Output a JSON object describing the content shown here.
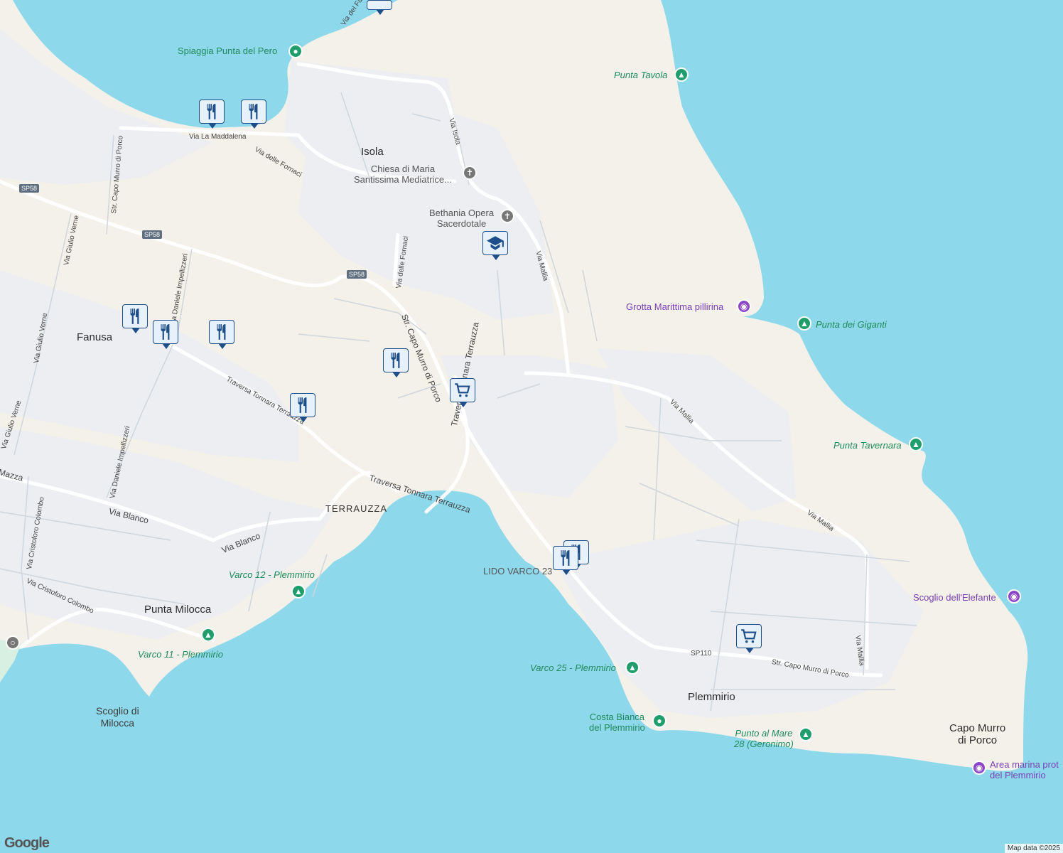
{
  "map": {
    "places": [
      {
        "key": "isola",
        "text": "Isola"
      },
      {
        "key": "fanusa",
        "text": "Fanusa"
      },
      {
        "key": "terrauzza",
        "text": "TERRAUZZA"
      },
      {
        "key": "punta-milocca",
        "text": "Punta Milocca"
      },
      {
        "key": "plemmirio",
        "text": "Plemmirio"
      },
      {
        "key": "capo-murro",
        "text": "Capo Murro\ndi Porco"
      },
      {
        "key": "scoglio-milocca",
        "text": "Scoglio di\nMilocca"
      }
    ],
    "pois": [
      {
        "key": "spiaggia",
        "text": "Spiaggia Punta del Pero",
        "kind": "green"
      },
      {
        "key": "punta-tavola",
        "text": "Punta Tavola",
        "kind": "green"
      },
      {
        "key": "chiesa",
        "text": "Chiesa di Maria\nSantissima Mediatrice...",
        "kind": "gray"
      },
      {
        "key": "bethania",
        "text": "Bethania Opera\nSacerdotale",
        "kind": "gray"
      },
      {
        "key": "grotta",
        "text": "Grotta Marittima pillirina",
        "kind": "purple"
      },
      {
        "key": "punta-giganti",
        "text": "Punta dei Giganti",
        "kind": "green"
      },
      {
        "key": "punta-tavernara",
        "text": "Punta Tavernara",
        "kind": "green"
      },
      {
        "key": "scoglio-elefante",
        "text": "Scoglio dell'Elefante",
        "kind": "purple"
      },
      {
        "key": "varco12",
        "text": "Varco 12 - Plemmirio",
        "kind": "green"
      },
      {
        "key": "varco11",
        "text": "Varco 11 - Plemmirio",
        "kind": "green"
      },
      {
        "key": "lido",
        "text": "LIDO VARCO 23",
        "kind": "gray"
      },
      {
        "key": "varco25",
        "text": "Varco 25 - Plemmirio",
        "kind": "green"
      },
      {
        "key": "costa-bianca",
        "text": "Costa Bianca\ndel Plemmirio",
        "kind": "green"
      },
      {
        "key": "punto-mare",
        "text": "Punto al Mare\n28 (Geronimo)",
        "kind": "green"
      },
      {
        "key": "area-marina",
        "text": "Area marina prot\ndel Plemmirio",
        "kind": "purple"
      }
    ],
    "roads": [
      {
        "key": "via-faro",
        "text": "Via del Faro Mas..."
      },
      {
        "key": "via-maddalena",
        "text": "Via La Maddalena"
      },
      {
        "key": "via-fornaci-1",
        "text": "Via delle Fornaci"
      },
      {
        "key": "via-isola",
        "text": "Via Isola"
      },
      {
        "key": "str-capo-1",
        "text": "Str. Capo Murro di Porco"
      },
      {
        "key": "via-giulio-1",
        "text": "Via Giulio Verne"
      },
      {
        "key": "via-giulio-2",
        "text": "Via Giulio Verne"
      },
      {
        "key": "via-giulio-3",
        "text": "Via Giulio Verne"
      },
      {
        "key": "via-daniele-1",
        "text": "Via Daniele Impellizzeri"
      },
      {
        "key": "via-daniele-2",
        "text": "Via Daniele Impellizzeri"
      },
      {
        "key": "via-fornaci-2",
        "text": "Via delle Fornaci"
      },
      {
        "key": "str-capo-2",
        "text": "Str. Capo Murro di Porco"
      },
      {
        "key": "via-mallia-1",
        "text": "Via Mallia"
      },
      {
        "key": "via-mallia-2",
        "text": "Via Mallia"
      },
      {
        "key": "via-mallia-3",
        "text": "Via Mallia"
      },
      {
        "key": "via-mallia-4",
        "text": "Via Mallia"
      },
      {
        "key": "trav-1",
        "text": "Traversa Tonnara Terrauzza"
      },
      {
        "key": "trav-2",
        "text": "Traversa Tonnara Terrauzza"
      },
      {
        "key": "trav-3",
        "text": "Traversa Tonnara Terrauzza"
      },
      {
        "key": "via-mazza",
        "text": "Mazza"
      },
      {
        "key": "via-blanco-1",
        "text": "Via Blanco"
      },
      {
        "key": "via-blanco-2",
        "text": "Via Blanco"
      },
      {
        "key": "via-cristoforo-1",
        "text": "Via Cristoforo Colombo"
      },
      {
        "key": "via-cristoforo-2",
        "text": "Via Cristoforo Colombo"
      },
      {
        "key": "sp110",
        "text": "SP110"
      },
      {
        "key": "str-capo-3",
        "text": "Str. Capo Murro di Porco"
      }
    ],
    "shields": [
      "SP58",
      "SP58",
      "SP58"
    ],
    "pins": {
      "restaurant_icon": "fork-knife-icon",
      "shop_icon": "cart-icon",
      "school_icon": "graduation-cap-icon"
    },
    "colors": {
      "water": "#8ed8ec",
      "land": "#f4f2ea",
      "urban": "#eef0f3",
      "road": "#ffffff",
      "pin_border": "#1d4e8a",
      "park": "#1f9d6b",
      "attraction": "#8a45c8"
    }
  },
  "branding": {
    "logo": "Google",
    "attribution": "Map data ©2025"
  }
}
